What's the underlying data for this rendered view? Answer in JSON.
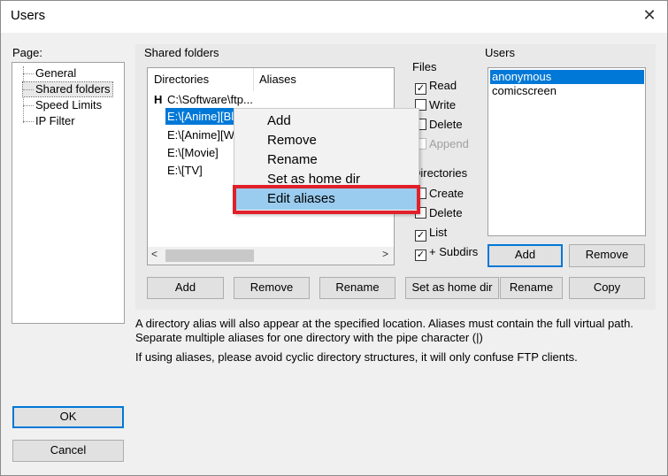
{
  "window": {
    "title": "Users",
    "close_icon": "✕"
  },
  "page_panel": {
    "label": "Page:",
    "items": [
      "General",
      "Shared folders",
      "Speed Limits",
      "IP Filter"
    ],
    "selected": "Shared folders"
  },
  "shared": {
    "label": "Shared folders",
    "columns": [
      "Directories",
      "Aliases"
    ],
    "rows": [
      {
        "flag": "H",
        "path": "C:\\Software\\ftp..."
      },
      {
        "flag": "",
        "path": "E:\\[Anime][Bl"
      },
      {
        "flag": "",
        "path": "E:\\[Anime][W"
      },
      {
        "flag": "",
        "path": "E:\\[Movie]"
      },
      {
        "flag": "",
        "path": "E:\\[TV]"
      }
    ],
    "buttons": {
      "add": "Add",
      "remove": "Remove",
      "rename": "Rename",
      "set_home": "Set as home dir"
    }
  },
  "files": {
    "label": "Files",
    "read": "Read",
    "write": "Write",
    "delete": "Delete",
    "append": "Append"
  },
  "directories": {
    "label": "Directories",
    "create": "Create",
    "delete": "Delete",
    "list": "List",
    "subdirs": "+ Subdirs"
  },
  "users": {
    "label": "Users",
    "items": [
      "anonymous",
      "comicscreen"
    ],
    "buttons": {
      "add": "Add",
      "remove": "Remove",
      "rename": "Rename",
      "copy": "Copy"
    }
  },
  "info": {
    "line1": "A directory alias will also appear at the specified location. Aliases must contain the full virtual path.",
    "line2": "Separate multiple aliases for one directory with the pipe character (|)",
    "line3": "If using aliases, please avoid cyclic directory structures, it will only confuse FTP clients."
  },
  "context_menu": {
    "items": [
      "Add",
      "Remove",
      "Rename",
      "Set as home dir",
      "Edit aliases"
    ],
    "highlighted": "Edit aliases"
  },
  "dialog_buttons": {
    "ok": "OK",
    "cancel": "Cancel"
  },
  "icons": {
    "check": "✓",
    "scroll_left": "<",
    "scroll_right": ">"
  },
  "colors": {
    "selection": "#0078d7",
    "menu_highlight": "#99ccee",
    "annotation_red": "#e0202a"
  }
}
